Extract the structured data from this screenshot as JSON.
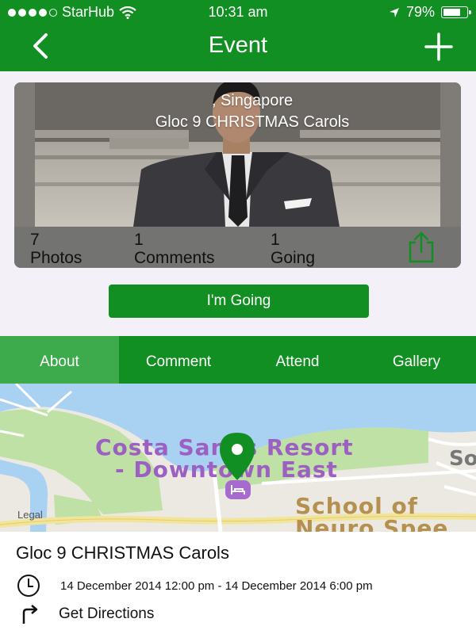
{
  "status_bar": {
    "carrier": "StarHub",
    "time": "10:31 am",
    "battery": "79%",
    "battery_level": 0.79,
    "signal_bars": 4,
    "signal_max": 5
  },
  "nav": {
    "title": "Event"
  },
  "event_card": {
    "location": ", Singapore",
    "name": "Gloc 9 CHRISTMAS Carols",
    "stats": [
      {
        "count": "7",
        "label": "Photos"
      },
      {
        "count": "1",
        "label": "Comments"
      },
      {
        "count": "1",
        "label": "Going"
      }
    ]
  },
  "going_button": "I'm Going",
  "tabs": [
    {
      "label": "About",
      "active": true
    },
    {
      "label": "Comment",
      "active": false
    },
    {
      "label": "Attend",
      "active": false
    },
    {
      "label": "Gallery",
      "active": false
    }
  ],
  "map": {
    "labels": [
      "Costa Sands Resort",
      "- Downtown East",
      "School of",
      "Neuro Spee",
      "So"
    ],
    "legal": "Legal"
  },
  "details": {
    "title": "Gloc 9 CHRISTMAS Carols",
    "datetime": "14 December 2014 12:00 pm - 14 December 2014 6:00 pm",
    "directions": "Get Directions"
  },
  "colors": {
    "brand_green": "#128f23",
    "active_tab": "#3daa4c"
  }
}
